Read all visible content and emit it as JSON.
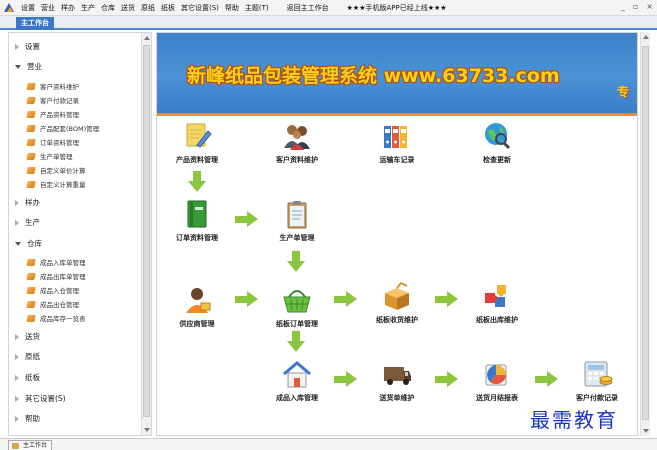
{
  "menu": {
    "items": [
      "设置",
      "营业",
      "样办",
      "生产",
      "仓库",
      "送货",
      "原纸",
      "纸板",
      "其它设置(S)",
      "帮助",
      "主题(T)",
      "返回主工作台",
      "★★★手机版APP已经上线★★★"
    ]
  },
  "window_controls": [
    "_",
    "▫",
    "×"
  ],
  "tab": {
    "label": "主工作台"
  },
  "sidebar": {
    "groups": [
      {
        "label": "设置",
        "expanded": false
      },
      {
        "label": "营业",
        "expanded": true,
        "items": [
          "客户资料维护",
          "客户付款记录",
          "产品资料管理",
          "产品配套(BOM)管理",
          "订单资料管理",
          "生产单管理",
          "自定义单价计算",
          "自定义计算重量"
        ]
      },
      {
        "label": "样办",
        "expanded": false
      },
      {
        "label": "生产",
        "expanded": false
      },
      {
        "label": "仓库",
        "expanded": true,
        "items": [
          "成品入库单管理",
          "成品出库单管理",
          "成品入仓管理",
          "成品出仓管理",
          "成品库存一览表"
        ]
      },
      {
        "label": "送货",
        "expanded": false
      },
      {
        "label": "原纸",
        "expanded": false
      },
      {
        "label": "纸板",
        "expanded": false
      },
      {
        "label": "其它设置(S)",
        "expanded": false
      },
      {
        "label": "帮助",
        "expanded": false
      }
    ]
  },
  "banner": {
    "title": "新峰纸品包装管理系统 www.63733.com",
    "side_text": "专"
  },
  "workflow": {
    "nodes": {
      "product": {
        "label": "产品资料管理",
        "icon": "pencil-note-icon"
      },
      "customer": {
        "label": "客户资料维护",
        "icon": "people-icon"
      },
      "transport": {
        "label": "运输车记录",
        "icon": "binders-icon"
      },
      "update": {
        "label": "检查更新",
        "icon": "globe-search-icon"
      },
      "order": {
        "label": "订单资料管理",
        "icon": "green-book-icon"
      },
      "production": {
        "label": "生产单管理",
        "icon": "clipboard-icon"
      },
      "supplier": {
        "label": "供应商管理",
        "icon": "supplier-icon"
      },
      "board_order": {
        "label": "纸板订单管理",
        "icon": "basket-icon"
      },
      "board_receive": {
        "label": "纸板收货维护",
        "icon": "box-icon"
      },
      "board_out": {
        "label": "纸板出库维护",
        "icon": "puzzle-icon"
      },
      "stock_in": {
        "label": "成品入库管理",
        "icon": "house-icon"
      },
      "delivery": {
        "label": "送货单维护",
        "icon": "van-icon"
      },
      "monthly": {
        "label": "送货月结报表",
        "icon": "report-icon"
      },
      "payment": {
        "label": "客户付款记录",
        "icon": "calculator-icon"
      }
    }
  },
  "status": {
    "tab_label": "主工作台"
  },
  "watermark": "最需教育",
  "colors": {
    "accent": "#3b78c3",
    "arrow": "#8cc63f",
    "banner_text": "#f6d21c",
    "divider": "#e8902a"
  }
}
